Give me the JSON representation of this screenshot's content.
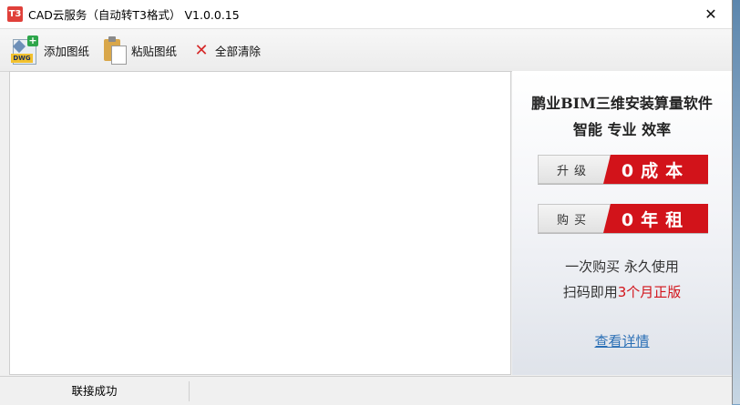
{
  "window": {
    "icon_label": "T3",
    "title": "CAD云服务（自动转T3格式） V1.0.0.15",
    "close_glyph": "✕"
  },
  "toolbar": {
    "add_label": "添加图纸",
    "add_icon_tag": "DWG",
    "add_icon_plus": "+",
    "paste_label": "粘贴图纸",
    "clear_label": "全部清除",
    "clear_glyph": "✕"
  },
  "promo": {
    "title": "鹏业BIM三维安装算量软件",
    "subtitle": "智能 专业 效率",
    "badge1_left": "升级",
    "badge1_right": "0成本",
    "badge2_left": "购买",
    "badge2_right": "0年租",
    "line1": "一次购买 永久使用",
    "line2_prefix": "扫码即用",
    "line2_highlight": "3个月正版",
    "link": "查看详情",
    "accent_color": "#d2131a",
    "link_color": "#2a6fb5"
  },
  "status": {
    "text": "联接成功"
  },
  "icons": {
    "app": "app-logo-icon",
    "add": "add-dwg-icon",
    "paste": "paste-clipboard-icon",
    "clear": "clear-x-icon",
    "close": "close-icon"
  }
}
